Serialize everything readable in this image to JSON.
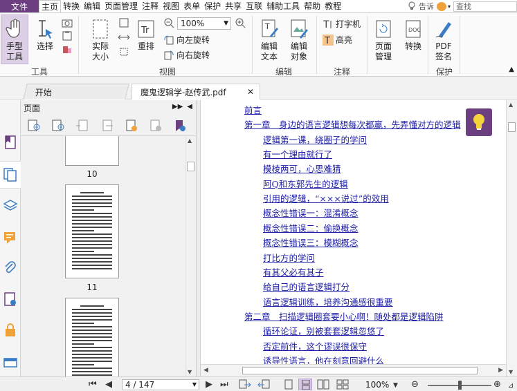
{
  "menubar": {
    "file": "文件",
    "items": [
      "主页",
      "转换",
      "编辑",
      "页面管理",
      "注释",
      "视图",
      "表单",
      "保护",
      "共享",
      "互联",
      "辅助工具",
      "帮助",
      "教程"
    ],
    "active_index": 0,
    "login": "告诉",
    "search_placeholder": "查找"
  },
  "ribbon": {
    "hand_tool": "手型\n工具",
    "select": "选择",
    "group_tools": "工具",
    "actual_size": "实际\n大小",
    "reflow": "重排",
    "zoom_value": "100%",
    "rotate_left": "向左旋转",
    "rotate_right": "向右旋转",
    "group_view": "视图",
    "edit_text": "编辑\n文本",
    "edit_object": "编辑\n对象",
    "group_edit": "编辑",
    "typewriter": "打字机",
    "highlight": "高亮",
    "group_comment": "注释",
    "page_manage": "页面\n管理",
    "convert": "转换",
    "pdf_sign": "PDF\n签名",
    "group_protect": "保护"
  },
  "tabs": {
    "start": "开始",
    "doc": "魔鬼逻辑学-赵传武.pdf"
  },
  "panel": {
    "title": "页面",
    "page_numbers": [
      "10",
      "11"
    ]
  },
  "toc": [
    {
      "text": "前言",
      "level": 0
    },
    {
      "text": "第一章　身边的语言逻辑想每次都赢，先弄懂对方的逻辑",
      "level": 0
    },
    {
      "text": "逻辑第一课，绕圈子的学问",
      "level": 1
    },
    {
      "text": "有一个理由就行了",
      "level": 1
    },
    {
      "text": "模棱两可，心思难猜",
      "level": 1
    },
    {
      "text": "阿Q和东郭先生的逻辑",
      "level": 1
    },
    {
      "text": "引用的逻辑，“×××说过”的效用",
      "level": 1
    },
    {
      "text": "概念性错误一：混淆概念",
      "level": 1
    },
    {
      "text": "概念性错误二：偷换概念",
      "level": 1
    },
    {
      "text": "概念性错误三：模糊概念",
      "level": 1
    },
    {
      "text": "打比方的学问",
      "level": 1
    },
    {
      "text": "有其父必有其子",
      "level": 1
    },
    {
      "text": "给自己的语言逻辑打分",
      "level": 1
    },
    {
      "text": "语言逻辑训练，培养沟通感很重要",
      "level": 1
    },
    {
      "text": "第二章　扫描逻辑圈套要小心啊！随处都是逻辑陷阱",
      "level": 0
    },
    {
      "text": "循环论证，别被套套逻辑忽悠了",
      "level": 1
    },
    {
      "text": "否定前件，这个谬误很保守",
      "level": 1
    },
    {
      "text": "诱导性语言，他在刻意回避什么",
      "level": 1
    }
  ],
  "status": {
    "page_indicator": "4 / 147",
    "zoom": "100%"
  },
  "colors": {
    "accent": "#6b3f80",
    "link": "#1e1ea8"
  }
}
